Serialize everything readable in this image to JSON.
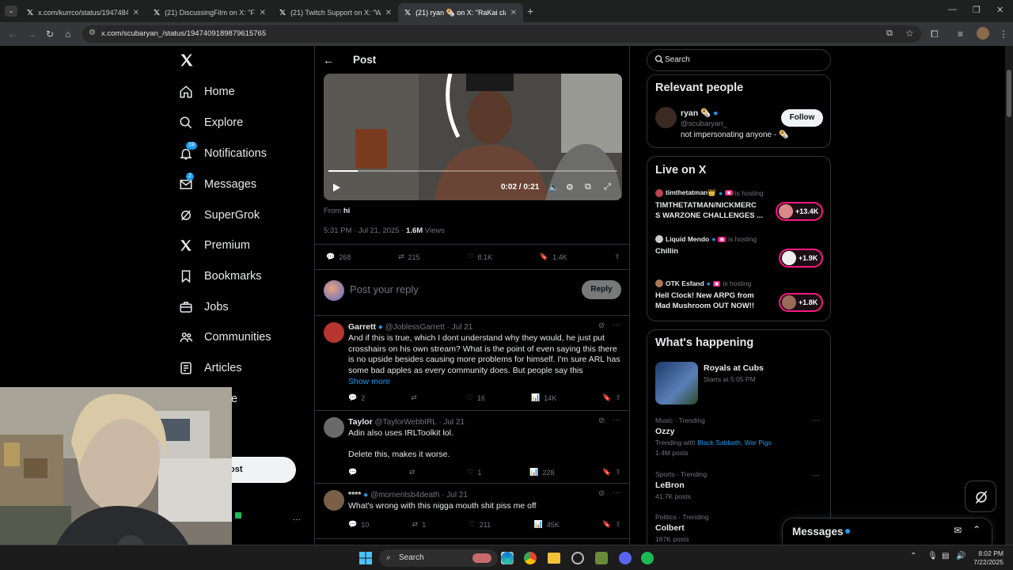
{
  "browser": {
    "tabs": [
      {
        "title": "x.com/kurrco/status/19474847"
      },
      {
        "title": "(21) DiscussingFilm on X: \"First"
      },
      {
        "title": "(21) Twitch Support on X: \"We'v"
      },
      {
        "title": "(21) ryan 🌯 on X: \"RaKai claim"
      }
    ],
    "url": "x.com/scubaryan_/status/1947409189879615765"
  },
  "nav": {
    "logo": "X",
    "items": [
      {
        "label": "Home"
      },
      {
        "label": "Explore"
      },
      {
        "label": "Notifications",
        "badge": "19"
      },
      {
        "label": "Messages",
        "badge": "2"
      },
      {
        "label": "SuperGrok"
      },
      {
        "label": "Premium"
      },
      {
        "label": "Bookmarks"
      },
      {
        "label": "Jobs"
      },
      {
        "label": "Communities"
      },
      {
        "label": "Articles"
      }
    ],
    "partial_more": "e",
    "partial_post": "ost",
    "more_dots": "···"
  },
  "post": {
    "header_title": "Post",
    "video_time": "0:02 / 0:21",
    "video_progress": 0.1,
    "from_label": "From",
    "from_name": "hi",
    "time": "5:31 PM · Jul 21, 2025 ·",
    "views_count": "1.6M",
    "views_label": "Views",
    "replies": "268",
    "reposts": "215",
    "likes": "8.1K",
    "bookmarks": "1.4K",
    "reply_placeholder": "Post your reply",
    "reply_button": "Reply"
  },
  "replies": [
    {
      "name": "Garrett",
      "handle": "@JoblessGarrett · Jul 21",
      "text": "And if this is true, which I dont understand why they would, he just put crosshairs on his own stream? What is the point of even saying this there is no upside besides causing more problems for himself. I'm sure ARL has some bad apples as every community does. But people say this",
      "show_more": "Show more",
      "replies": "2",
      "reposts": "",
      "likes": "16",
      "views": "14K"
    },
    {
      "name": "Taylor",
      "handle": "@TaylorWebbIRL · Jul 21",
      "text": "Adin also uses IRLToolkit lol.",
      "text2": "Delete this, makes it worse.",
      "replies": "",
      "reposts": "",
      "likes": "1",
      "views": "228"
    },
    {
      "name": "****",
      "handle": "@momentsb4death · Jul 21",
      "text": "What's wrong with this nigga mouth shit piss me off",
      "replies": "10",
      "reposts": "1",
      "likes": "211",
      "views": "45K"
    }
  ],
  "sidebar": {
    "search_placeholder": "Search",
    "relevant": {
      "title": "Relevant people",
      "name": "ryan 🌯",
      "handle": "@scubaryan_",
      "bio": "not impersonating anyone - 🌯",
      "follow": "Follow"
    },
    "live": {
      "title": "Live on X",
      "items": [
        {
          "host": "timthetatman👑",
          "status": "is hosting",
          "title1": "TIMTHETATMAN/NICKMERC",
          "title2": "S WARZONE CHALLENGES ...",
          "count": "+13.4K"
        },
        {
          "host": "Liquid Mendo",
          "status": "is hosting",
          "title1": "Chillin",
          "title2": "",
          "count": "+1.9K"
        },
        {
          "host": "OTK Esfand",
          "status": "is hosting",
          "title1": "Hell Clock! New ARPG from",
          "title2": "Mad Mushroom OUT NOW!!",
          "count": "+1.8K"
        }
      ]
    },
    "happening": {
      "title": "What's happening",
      "event_title": "Royals at Cubs",
      "event_time": "Starts at 5:05 PM",
      "trends": [
        {
          "category": "Music · Trending",
          "name": "Ozzy",
          "with_label": "Trending with",
          "with": "Black Sabbath, War Pigs",
          "posts": "1.4M posts"
        },
        {
          "category": "Sports · Trending",
          "name": "LeBron",
          "with_label": "",
          "with": "",
          "posts": "41.7K posts"
        },
        {
          "category": "Politics · Trending",
          "name": "Colbert",
          "with_label": "",
          "with": "",
          "posts": "187K posts"
        }
      ]
    },
    "messages_drawer": "Messages"
  },
  "taskbar": {
    "search": "Search",
    "time": "8:02 PM",
    "date": "7/22/2025"
  },
  "colors": {
    "accent": "#1d9bf0",
    "live_pink": "#f91880"
  }
}
